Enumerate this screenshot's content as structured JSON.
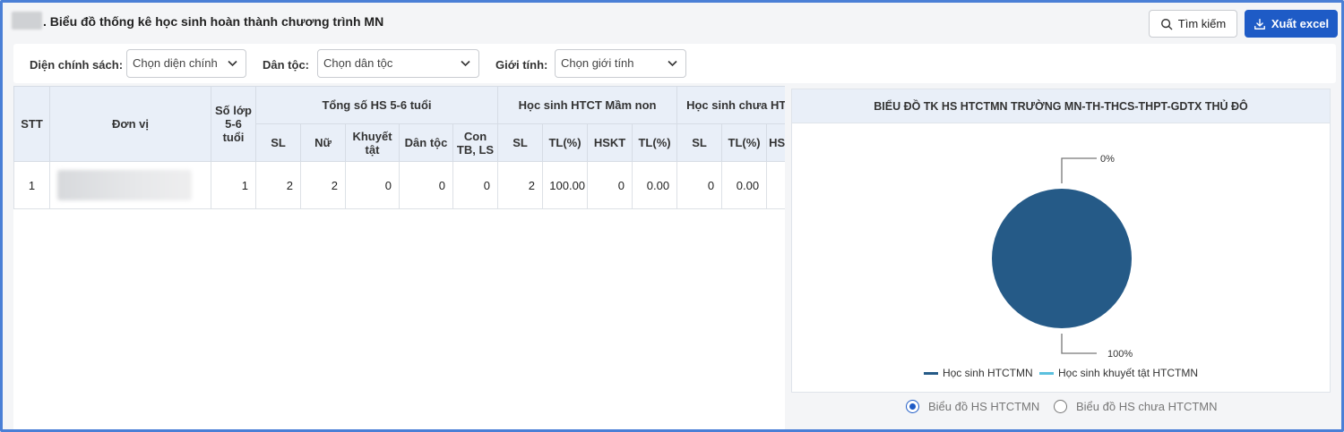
{
  "header": {
    "title": ". Biểu đồ thống kê học sinh hoàn thành chương trình MN",
    "search_label": "Tìm kiếm",
    "export_label": "Xuất excel"
  },
  "filters": {
    "policy_label": "Diện chính sách:",
    "policy_value": "Chọn diện chính",
    "ethnic_label": "Dân tộc:",
    "ethnic_value": "Chọn dân tộc",
    "gender_label": "Giới tính:",
    "gender_value": "Chọn giới tính"
  },
  "table": {
    "headers": {
      "stt": "STT",
      "unit": "Đơn vị",
      "classes": "Số lớp 5-6 tuổi",
      "group_total": "Tổng số HS 5-6 tuổi",
      "group_completed": "Học sinh HTCT Mầm non",
      "group_not": "Học sinh chưa HTCT",
      "sl": "SL",
      "female": "Nữ",
      "disabled": "Khuyết tật",
      "ethnic": "Dân tộc",
      "martyr": "Con TB, LS",
      "sl2": "SL",
      "tl1": "TL(%)",
      "hskt": "HSKT",
      "tl2": "TL(%)",
      "sl3": "SL",
      "tl3": "TL(%)",
      "hs": "HS"
    },
    "rows": [
      {
        "stt": "1",
        "classes": "1",
        "sl": "2",
        "female": "2",
        "disabled": "0",
        "ethnic": "0",
        "martyr": "0",
        "completed_sl": "2",
        "completed_tl": "100.00",
        "hskt": "0",
        "hskt_tl": "0.00",
        "not_sl": "0",
        "not_tl": "0.00"
      }
    ]
  },
  "chart": {
    "title": "BIỂU ĐỒ TK HS HTCTMN TRƯỜNG MN-TH-THCS-THPT-GDTX THỦ ĐÔ",
    "label_top": "0%",
    "label_bottom": "100%",
    "legend": [
      "Học sinh HTCTMN",
      "Học sinh khuyết tật HTCTMN"
    ]
  },
  "chart_data": {
    "type": "pie",
    "categories": [
      "Học sinh HTCTMN",
      "Học sinh khuyết tật HTCTMN"
    ],
    "values": [
      100,
      0
    ],
    "colors": [
      "#255a87",
      "#5bc0de"
    ],
    "title": "BIỂU ĐỒ TK HS HTCTMN TRƯỜNG MN-TH-THCS-THPT-GDTX THỦ ĐÔ",
    "legend_placement": "bottom"
  },
  "radios": {
    "option1": "Biểu đồ HS HTCTMN",
    "option2": "Biểu đồ HS chưa HTCTMN"
  }
}
